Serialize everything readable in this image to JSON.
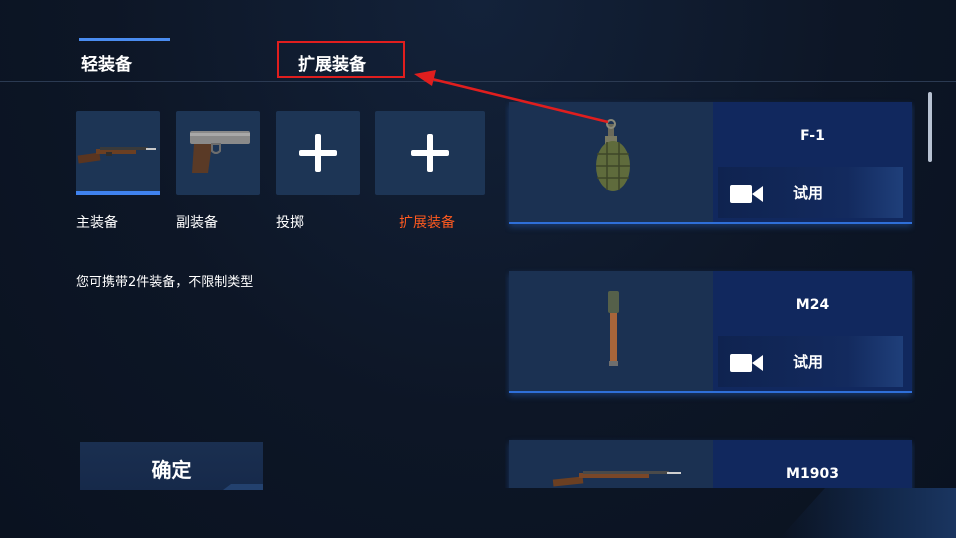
{
  "tabs": [
    {
      "label": "轻装备",
      "active": true
    },
    {
      "label": "扩展装备",
      "active": false
    }
  ],
  "slots": [
    {
      "label": "主装备",
      "icon": "rifle-icon",
      "selected": true
    },
    {
      "label": "副装备",
      "icon": "pistol-icon"
    },
    {
      "label": "投掷",
      "icon": "plus-icon"
    },
    {
      "label": "扩展装备",
      "icon": "plus-icon",
      "highlight_color": "#ff5a1f"
    }
  ],
  "info_text": "您可携带2件装备，不限制类型",
  "confirm_label": "确定",
  "items": [
    {
      "name": "F-1",
      "trial_label": "试用",
      "icon": "grenade-icon"
    },
    {
      "name": "M24",
      "trial_label": "试用",
      "icon": "stick-grenade-icon"
    },
    {
      "name": "M1903",
      "icon": "rifle-icon"
    }
  ],
  "colors": {
    "accent_blue": "#3f82ef",
    "annotation_red": "#e01e1e",
    "highlight_orange": "#ff5a1f"
  }
}
